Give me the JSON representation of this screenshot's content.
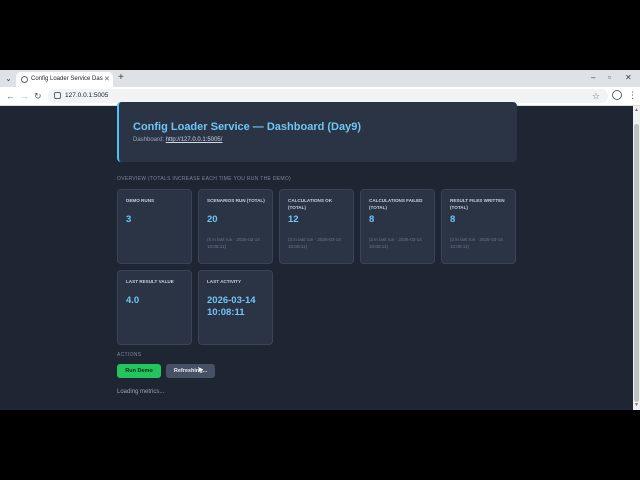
{
  "browser": {
    "tab_title": "Config Loader Service Dashboard",
    "url": "127.0.0.1:5005"
  },
  "header": {
    "title": "Config Loader Service — Dashboard (Day9)",
    "dashboard_label": "Dashboard:",
    "dashboard_link": "http://127.0.0.1:5005/"
  },
  "overview": {
    "label": "Overview (totals increase each time you run the demo)",
    "cards": [
      {
        "label": "Demo runs",
        "value": "3",
        "sub": ""
      },
      {
        "label": "Scenarios run (total)",
        "value": "20",
        "sub": "(5 in last run · 2026-03-14 10:08:11)"
      },
      {
        "label": "Calculations OK (total)",
        "value": "12",
        "sub": "(3 in last run · 2026-03-14 10:08:11)"
      },
      {
        "label": "Calculations failed (total)",
        "value": "8",
        "sub": "(2 in last run · 2026-03-14 10:08:11)"
      },
      {
        "label": "Result files written (total)",
        "value": "8",
        "sub": "(2 in last run · 2026-03-14 10:08:11)"
      },
      {
        "label": "Last result value",
        "value": "4.0",
        "sub": ""
      },
      {
        "label": "Last activity",
        "value": "2026-03-14 10:08:11",
        "sub": ""
      }
    ]
  },
  "actions": {
    "label": "Actions",
    "run_label": "Run Demo",
    "refresh_label": "Refreshing..."
  },
  "status": "Loading metrics..."
}
